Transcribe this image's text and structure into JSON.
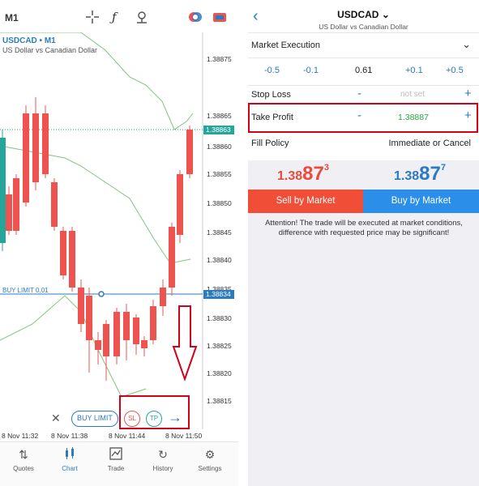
{
  "left": {
    "topbar": {
      "timeframe": "M1"
    },
    "symbol": {
      "title": "USDCAD • M1",
      "subtitle": "US Dollar vs Canadian Dollar"
    },
    "price_axis": [
      "1.38875",
      "1.38865",
      "1.38860",
      "1.38855",
      "1.38850",
      "1.38845",
      "1.38840",
      "1.38835",
      "1.38830",
      "1.38825",
      "1.38820",
      "1.38815"
    ],
    "current_price_tag": "1.38863",
    "buy_limit_tag": "1.38834",
    "buy_limit_label": "BUY LIMIT 0.01",
    "time_axis": [
      "8 Nov 11:32",
      "8 Nov 11:38",
      "8 Nov 11:44",
      "8 Nov 11:50"
    ],
    "order_bar": {
      "close": "✕",
      "buy_limit": "BUY LIMIT",
      "sl": "SL",
      "tp": "TP",
      "arrow": "→"
    },
    "nav": [
      {
        "label": "Quotes",
        "icon": "⇅"
      },
      {
        "label": "Chart",
        "icon": "│"
      },
      {
        "label": "Trade",
        "icon": "∿"
      },
      {
        "label": "History",
        "icon": "↻"
      },
      {
        "label": "Settings",
        "icon": "⚙"
      }
    ],
    "colors": {
      "up": "#26a69a",
      "down": "#ef5350",
      "bands": "#7cc77c",
      "accent": "#2b7bc0"
    }
  },
  "right": {
    "header": {
      "title": "USDCAD",
      "caret": "⌄",
      "subtitle": "US Dollar vs Canadian Dollar",
      "back": "‹"
    },
    "execution": {
      "label": "Market Execution",
      "chevron": "⌄"
    },
    "volume": {
      "m05": "-0.5",
      "m01": "-0.1",
      "value": "0.61",
      "p01": "+0.1",
      "p05": "+0.5"
    },
    "stop_loss": {
      "label": "Stop Loss",
      "minus": "-",
      "value": "not set",
      "plus": "+"
    },
    "take_profit": {
      "label": "Take Profit",
      "minus": "-",
      "value": "1.38887",
      "plus": "+"
    },
    "fill_policy": {
      "label": "Fill Policy",
      "value": "Immediate or Cancel"
    },
    "bid": {
      "main": "1.38",
      "big": "87",
      "sup": "3"
    },
    "ask": {
      "main": "1.38",
      "big": "87",
      "sup": "7"
    },
    "sell_label": "Sell by Market",
    "buy_label": "Buy by Market",
    "attention": "Attention! The trade will be executed at market conditions, difference with requested price may be significant!"
  }
}
